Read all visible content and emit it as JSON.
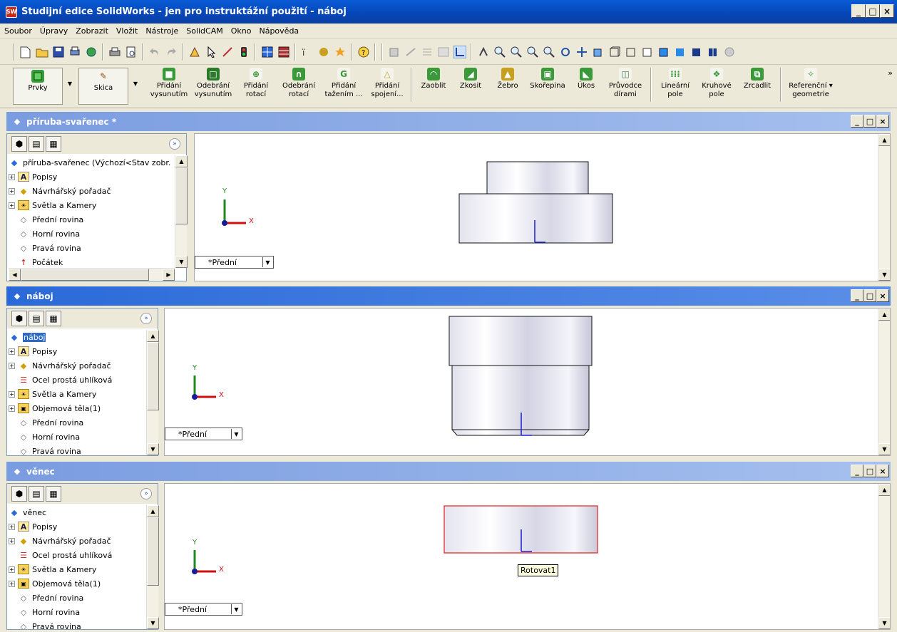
{
  "app": {
    "title": "Studijní edice SolidWorks - jen pro instruktážní použití - náboj",
    "icon_text": "SW"
  },
  "window_buttons": {
    "minimize": "_",
    "maximize": "□",
    "close": "×"
  },
  "menu": [
    "Soubor",
    "Úpravy",
    "Zobrazit",
    "Vložit",
    "Nástroje",
    "SolidCAM",
    "Okno",
    "Nápověda"
  ],
  "toolbar2": {
    "features": "Prvky",
    "sketch": "Skica",
    "commands": [
      [
        "Přidání",
        "vysunutím"
      ],
      [
        "Odebrání",
        "vysunutím"
      ],
      [
        "Přidání",
        "rotací"
      ],
      [
        "Odebrání",
        "rotací"
      ],
      [
        "Přidání",
        "tažením ..."
      ],
      [
        "Přidání",
        "spojení..."
      ],
      [
        "Zaoblit",
        ""
      ],
      [
        "Zkosit",
        ""
      ],
      [
        "Žebro",
        ""
      ],
      [
        "Skořepina",
        ""
      ],
      [
        "Úkos",
        ""
      ],
      [
        "Průvodce",
        "dírami"
      ],
      [
        "Lineární",
        "pole"
      ],
      [
        "Kruhové",
        "pole"
      ],
      [
        "Zrcadlit",
        ""
      ],
      [
        "Referenční ▾",
        "geometrie"
      ]
    ],
    "more": "»"
  },
  "docs": [
    {
      "title": "příruba-svařenec *",
      "tree": [
        {
          "label": "příruba-svařenec  (Výchozí<Stav zobr.",
          "icon": "part",
          "plus": false,
          "root": true
        },
        {
          "label": "Popisy",
          "icon": "annot",
          "plus": true
        },
        {
          "label": "Návrhářský pořadač",
          "icon": "design",
          "plus": true
        },
        {
          "label": "Světla a Kamery",
          "icon": "lights",
          "plus": true
        },
        {
          "label": "Přední rovina",
          "icon": "plane",
          "plus": false
        },
        {
          "label": "Horní rovina",
          "icon": "plane",
          "plus": false
        },
        {
          "label": "Pravá rovina",
          "icon": "plane",
          "plus": false
        },
        {
          "label": "Počátek",
          "icon": "origin",
          "plus": false
        }
      ],
      "view": "*Přední"
    },
    {
      "title": "náboj",
      "tree": [
        {
          "label": "náboj",
          "icon": "part",
          "plus": false,
          "root": true,
          "selected": true
        },
        {
          "label": "Popisy",
          "icon": "annot",
          "plus": true
        },
        {
          "label": "Návrhářský pořadač",
          "icon": "design",
          "plus": true
        },
        {
          "label": "Ocel prostá uhlíková",
          "icon": "material",
          "plus": false
        },
        {
          "label": "Světla a Kamery",
          "icon": "lights",
          "plus": true
        },
        {
          "label": "Objemová těla(1)",
          "icon": "solid",
          "plus": true
        },
        {
          "label": "Přední rovina",
          "icon": "plane",
          "plus": false
        },
        {
          "label": "Horní rovina",
          "icon": "plane",
          "plus": false
        },
        {
          "label": "Pravá rovina",
          "icon": "plane",
          "plus": false
        }
      ],
      "view": "*Přední"
    },
    {
      "title": "věnec",
      "tree": [
        {
          "label": "věnec",
          "icon": "part",
          "plus": false,
          "root": true
        },
        {
          "label": "Popisy",
          "icon": "annot",
          "plus": true
        },
        {
          "label": "Návrhářský pořadač",
          "icon": "design",
          "plus": true
        },
        {
          "label": "Ocel prostá uhlíková",
          "icon": "material",
          "plus": false
        },
        {
          "label": "Světla a Kamery",
          "icon": "lights",
          "plus": true
        },
        {
          "label": "Objemová těla(1)",
          "icon": "solid",
          "plus": true
        },
        {
          "label": "Přední rovina",
          "icon": "plane",
          "plus": false
        },
        {
          "label": "Horní rovina",
          "icon": "plane",
          "plus": false
        },
        {
          "label": "Pravá rovina",
          "icon": "plane",
          "plus": false
        }
      ],
      "view": "*Přední",
      "tooltip": "Rotovat1"
    }
  ],
  "axis": {
    "x": "X",
    "y": "Y"
  },
  "colors": {
    "title_active": "#2a6ad8",
    "title_inactive": "#7a9ce0",
    "selection": "#316ac5",
    "edge_highlight": "#e02020"
  }
}
